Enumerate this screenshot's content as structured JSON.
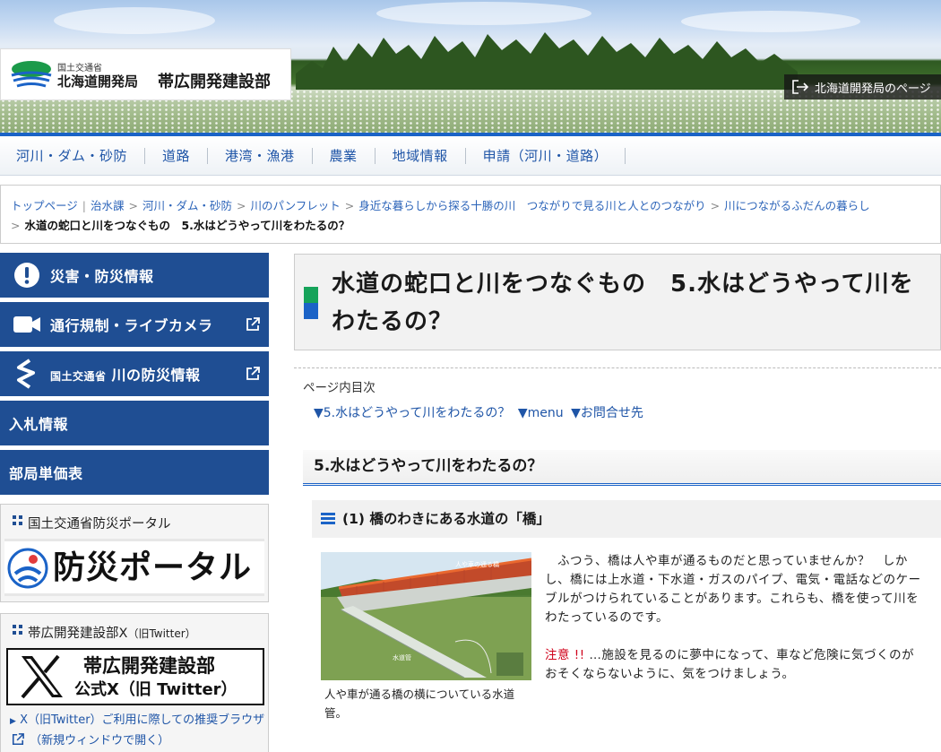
{
  "header": {
    "ministry": "国土交通省",
    "bureau": "北海道開発局",
    "office": "帯広開発建設部",
    "hq_link": "北海道開発局のページ"
  },
  "nav": {
    "items": [
      {
        "label": "河川・ダム・砂防"
      },
      {
        "label": "道路"
      },
      {
        "label": "港湾・漁港"
      },
      {
        "label": "農業"
      },
      {
        "label": "地域情報"
      },
      {
        "label": "申請（河川・道路）"
      }
    ]
  },
  "breadcrumb": {
    "items": [
      "トップページ",
      "治水課",
      "河川・ダム・砂防",
      "川のパンフレット",
      "身近な暮らしから探る十勝の川　つながりで見る川と人とのつながり",
      "川につながるふだんの暮らし"
    ],
    "current": "水道の蛇口と川をつなぐもの　5.水はどうやって川をわたるの？"
  },
  "sidebar": {
    "buttons": {
      "disaster": "災害・防災情報",
      "traffic": "通行規制・ライブカメラ",
      "river_small": "国土交通省",
      "river": "川の防災情報",
      "bidding": "入札情報",
      "unit_price": "部局単価表"
    },
    "portal": {
      "title": "国土交通省防災ポータル",
      "banner": "防災ポータル"
    },
    "x_box": {
      "title": "帯広開発建設部X",
      "title_sub": "（旧Twitter）",
      "banner_line1": "帯広開発建設部",
      "banner_line2": "公式X（旧 Twitter）",
      "link_a": "X（旧Twitter）ご利用に際しての推奨ブラウザ",
      "link_b": "（新規ウィンドウで開く）"
    }
  },
  "main": {
    "title": "水道の蛇口と川をつなぐもの　5.水はどうやって川をわたるの？",
    "toc_title": "ページ内目次",
    "toc": [
      "▼5.水はどうやって川をわたるの？",
      "▼menu",
      "▼お問合せ先"
    ],
    "h2": "5.水はどうやって川をわたるの？",
    "h3": "(1) 橋のわきにある水道の「橋」",
    "photo_label_top": "人や車の通る橋",
    "photo_label_pipe": "水道管",
    "photo_caption": "人や車が通る橋の横についている水道管。",
    "para1": "　ふつう、橋は人や車が通るものだと思っていませんか？　しかし、橋には上水道・下水道・ガスのパイプ、電気・電話などのケーブルがつけられていることがあります。これらも、橋を使って川をわたっているのです。",
    "caution_label": "注意 !!",
    "caution_text": " …施設を見るのに夢中になって、車など危険に気づくのがおそくならないように、気をつけましょう。"
  },
  "colors": {
    "nav_blue": "#1b63c7",
    "sidebar_blue": "#1f4e93",
    "link_blue": "#1f55a7",
    "caution_red": "#d0021b",
    "title_green": "#16a35a"
  }
}
